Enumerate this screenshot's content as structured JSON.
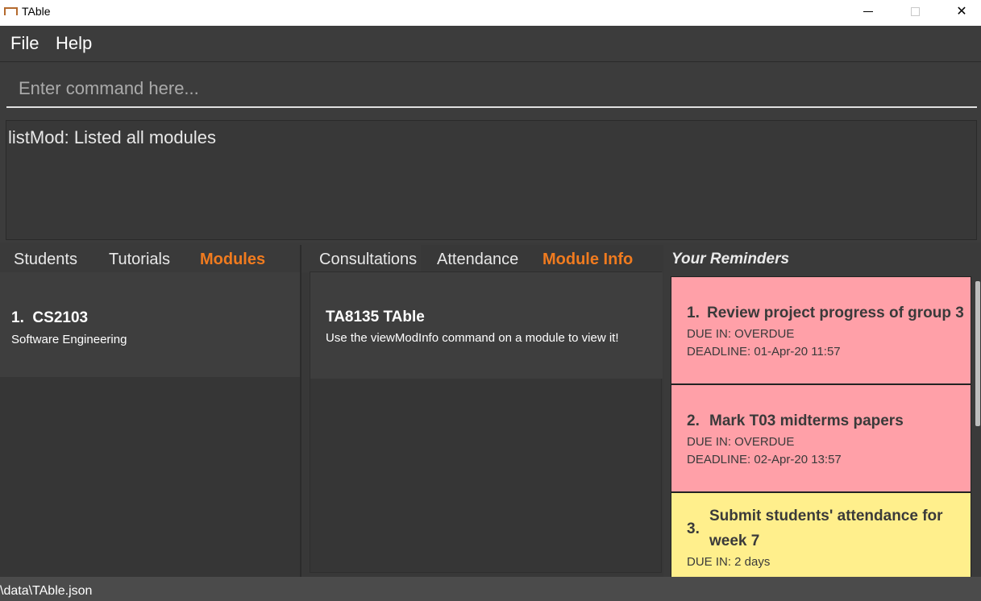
{
  "window": {
    "title": "TAble"
  },
  "menu": {
    "file": "File",
    "help": "Help"
  },
  "command": {
    "placeholder": "Enter command here...",
    "value": ""
  },
  "result": {
    "text": "listMod: Listed all modules"
  },
  "left_pane": {
    "tabs": [
      {
        "label": "Students",
        "active": false
      },
      {
        "label": "Tutorials",
        "active": false
      },
      {
        "label": "Modules",
        "active": true
      }
    ],
    "modules": [
      {
        "index": "1.",
        "code": "CS2103",
        "name": "Software Engineering"
      }
    ]
  },
  "mid_pane": {
    "tabs": [
      {
        "label": "Consultations",
        "active": false
      },
      {
        "label": "Attendance",
        "active": false
      },
      {
        "label": "Module Info",
        "active": true
      }
    ],
    "info": {
      "title": "TA8135 TAble",
      "message": "Use the viewModInfo command on a module to view it!"
    }
  },
  "reminders": {
    "header": "Your Reminders",
    "items": [
      {
        "index": "1.",
        "title": "Review project progress of group 3",
        "due": "DUE IN: OVERDUE",
        "deadline": "DEADLINE: 01-Apr-20 11:57",
        "color": "#ffa0a8"
      },
      {
        "index": "2.",
        "title": "Mark T03 midterms papers",
        "due": "DUE IN: OVERDUE",
        "deadline": "DEADLINE: 02-Apr-20 13:57",
        "color": "#ffa0a8"
      },
      {
        "index": "3.",
        "title": "Submit students' attendance for week 7",
        "due": "DUE IN: 2 days",
        "deadline": "",
        "color": "#ffef8c"
      }
    ]
  },
  "status": {
    "path": "\\data\\TAble.json"
  },
  "colors": {
    "accent": "#f07b1f",
    "overdue": "#ffa0a8",
    "upcoming": "#ffef8c",
    "background": "#3a3a3a"
  }
}
